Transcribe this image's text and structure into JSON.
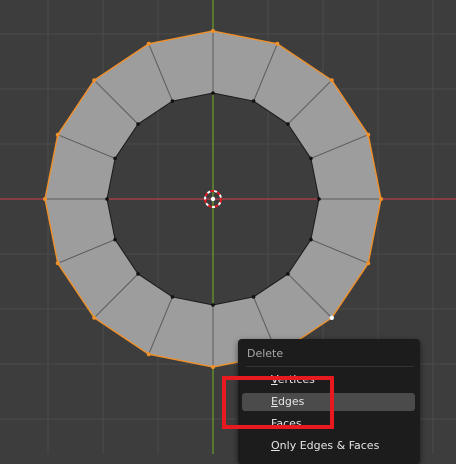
{
  "viewport": {
    "colors": {
      "background": "#3d3d3d",
      "grid": "#4a4a4a",
      "x_axis": "#b33e48",
      "y_axis": "#6e9e2a",
      "face": "#9d9d9d",
      "selected_edge": "#f0902a",
      "unselected_edge": "#1a1a1a",
      "cursor_red": "#e8191f"
    }
  },
  "context_menu": {
    "title": "Delete",
    "items": [
      {
        "name": "menu-item-vertices",
        "label": "Vertices",
        "mnemonic": "V",
        "rest": "ertices",
        "active": false
      },
      {
        "name": "menu-item-edges",
        "label": "Edges",
        "mnemonic": "E",
        "rest": "dges",
        "active": true
      },
      {
        "name": "menu-item-faces",
        "label": "Faces",
        "mnemonic": "F",
        "rest": "aces",
        "active": false
      },
      {
        "name": "menu-item-only-edges-faces",
        "label": "Only Edges & Faces",
        "mnemonic": "O",
        "rest": "nly Edges & Faces",
        "active": false
      }
    ],
    "highlight_color": "#e8191f"
  }
}
